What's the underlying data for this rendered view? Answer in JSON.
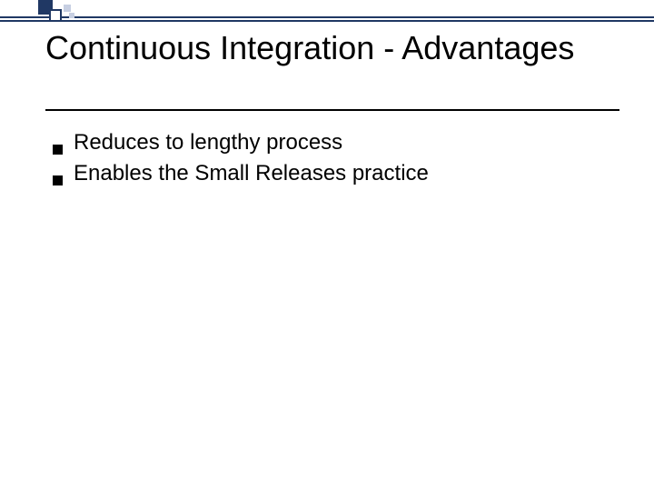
{
  "slide": {
    "title": "Continuous Integration - Advantages",
    "bullets": [
      "Reduces to lengthy process",
      "Enables the Small Releases practice"
    ]
  }
}
